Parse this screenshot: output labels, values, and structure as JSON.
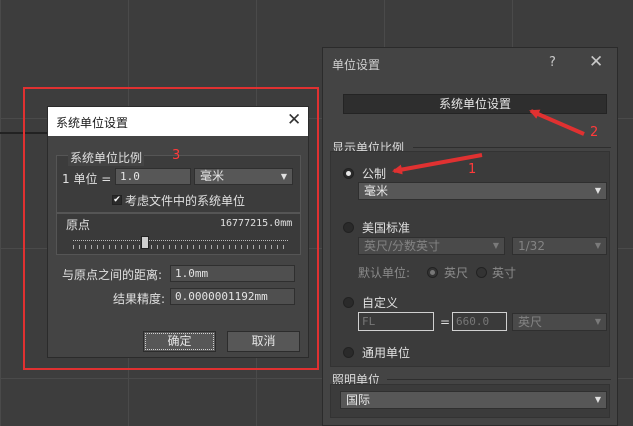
{
  "units_dialog": {
    "title": "单位设置",
    "help_label": "?",
    "close_label": "✕",
    "system_unit_setup_button": "系统单位设置",
    "display_scale": {
      "section_label": "显示单位比例",
      "metric_label": "公制",
      "metric_selected": true,
      "metric_value": "毫米",
      "us_standard_label": "美国标准",
      "us_unit_value": "英尺/分数英寸",
      "us_fraction_value": "1/32",
      "default_unit_label": "默认单位:",
      "default_feet_label": "英尺",
      "default_inches_label": "英寸",
      "custom_label": "自定义",
      "custom_name_value": "FL",
      "custom_equals": "=",
      "custom_amount_value": "660.0",
      "custom_unit_value": "英尺",
      "generic_label": "通用单位"
    },
    "lighting": {
      "section_label": "照明单位",
      "value": "国际"
    }
  },
  "system_dialog": {
    "title": "系统单位设置",
    "close_label": "✕",
    "scale_group_label": "系统单位比例",
    "scale_prefix": "1 单位 =",
    "scale_value": "1.0",
    "scale_unit": "毫米",
    "respect_file_units_label": "考虑文件中的系统单位",
    "respect_file_units_checked": true,
    "origin_label": "原点",
    "origin_value": "16777215.0mm",
    "distance_label": "与原点之间的距离:",
    "distance_value": "1.0mm",
    "precision_label": "结果精度:",
    "precision_value": "0.0000001192mm",
    "ok_label": "确定",
    "cancel_label": "取消"
  },
  "annotations": {
    "n1": "1",
    "n2": "2",
    "n3": "3",
    "color": "#ff3a3a"
  }
}
